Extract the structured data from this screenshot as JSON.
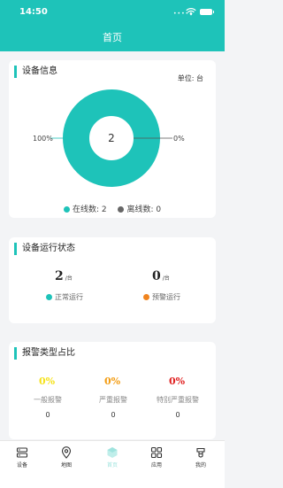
{
  "status_bar": {
    "time": "14:50",
    "signal": "•••••"
  },
  "header": {
    "title": "首页"
  },
  "device_info": {
    "title": "设备信息",
    "unit": "单位: 台",
    "center_value": "2",
    "online_percent": "100%",
    "offline_percent": "0%",
    "legend": {
      "online": "在线数: 2",
      "offline": "离线数: 0"
    }
  },
  "chart_data": {
    "type": "pie",
    "categories": [
      "在线数",
      "离线数"
    ],
    "values": [
      2,
      0
    ],
    "colors": [
      "#1ec3b9",
      "#666666"
    ]
  },
  "run_status": {
    "title": "设备运行状态",
    "normal": {
      "count": "2",
      "unit": "/台",
      "label": "正常运行"
    },
    "warning": {
      "count": "0",
      "unit": "/台",
      "label": "预警运行"
    }
  },
  "alarm": {
    "title": "报警类型占比",
    "items": [
      {
        "percent": "0%",
        "label": "一般报警",
        "count": "0",
        "color": "#f5e21a"
      },
      {
        "percent": "0%",
        "label": "严重报警",
        "count": "0",
        "color": "#f39c12"
      },
      {
        "percent": "0%",
        "label": "特别严重报警",
        "count": "0",
        "color": "#e02020"
      }
    ]
  },
  "tabbar": {
    "items": [
      {
        "label": "设备",
        "icon": "device-icon"
      },
      {
        "label": "地图",
        "icon": "map-pin-icon"
      },
      {
        "label": "首页",
        "icon": "home-icon",
        "active": true
      },
      {
        "label": "应用",
        "icon": "apps-grid-icon"
      },
      {
        "label": "我的",
        "icon": "profile-icon"
      }
    ]
  }
}
